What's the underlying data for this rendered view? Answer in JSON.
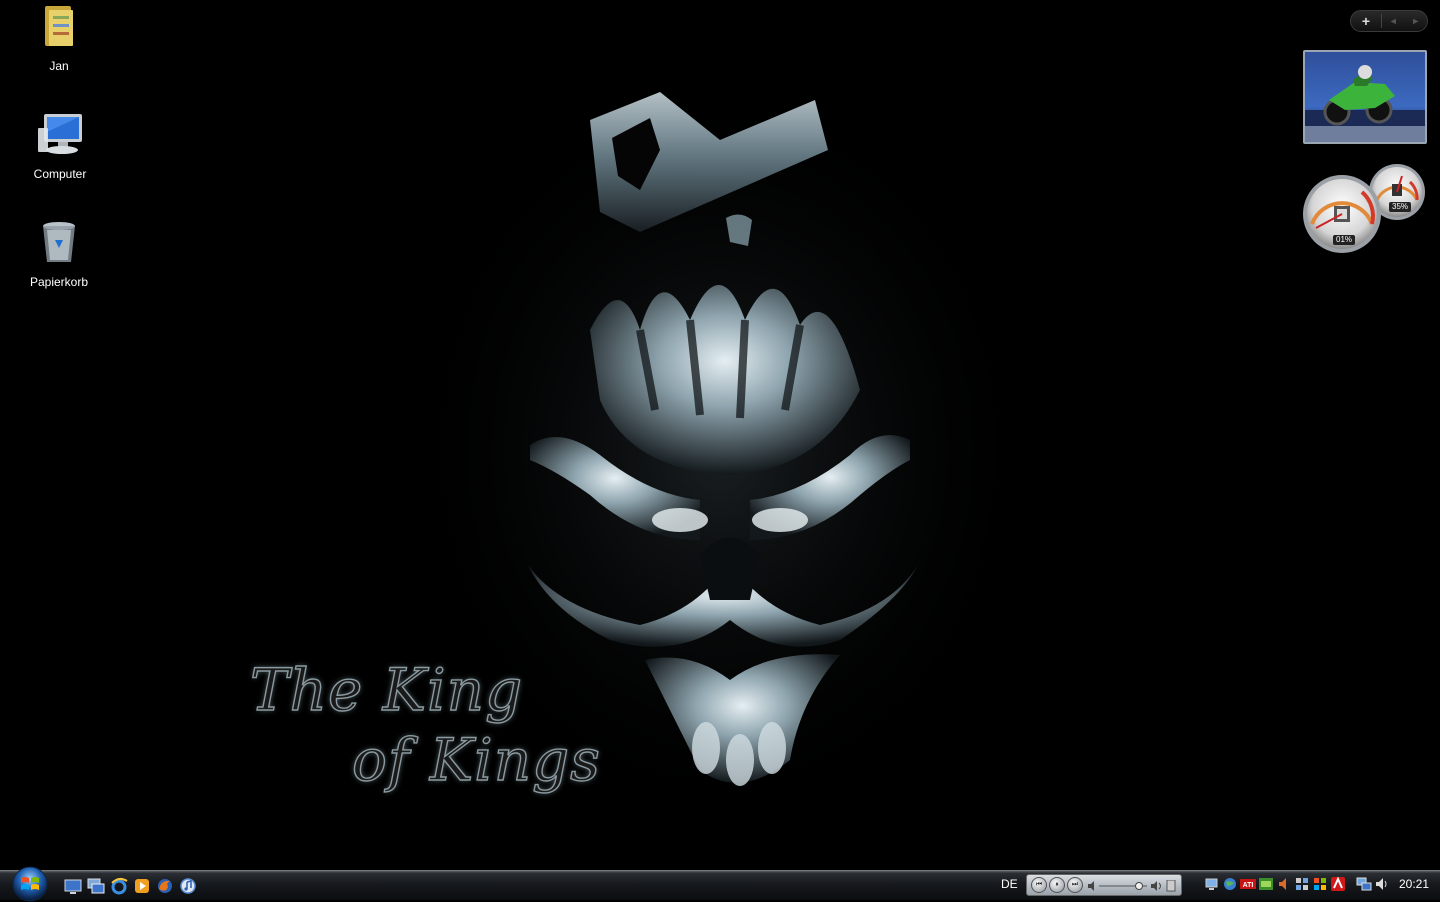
{
  "wallpaper": {
    "line1": "The King",
    "line2": "of Kings"
  },
  "desktop_icons": [
    {
      "label": "Jan",
      "icon": "user-folder-icon"
    },
    {
      "label": "Computer",
      "icon": "computer-icon"
    },
    {
      "label": "Papierkorb",
      "icon": "recycle-bin-icon"
    }
  ],
  "sidebar": {
    "add_glyph": "+",
    "prev_glyph": "◄",
    "next_glyph": "►"
  },
  "gadgets": {
    "slideshow": {
      "icon": "slideshow-motorcycle-image"
    },
    "meter": {
      "cpu": "01%",
      "memory": "35%"
    }
  },
  "taskbar": {
    "start_icon": "windows-start-orb",
    "quicklaunch": [
      "show-desktop-icon",
      "switch-windows-icon",
      "internet-explorer-icon",
      "media-player-icon",
      "firefox-icon",
      "itunes-icon"
    ],
    "language": "DE",
    "media": {
      "prev": "⏮",
      "pause": "⏸",
      "next": "⏭"
    },
    "clock": "20:21"
  },
  "colors": {
    "taskbar_top": "#5a5f66",
    "taskbar_bottom": "#0b0d10",
    "wallpaper_bg": "#000000",
    "skull_tone": "#8fa6b1"
  }
}
